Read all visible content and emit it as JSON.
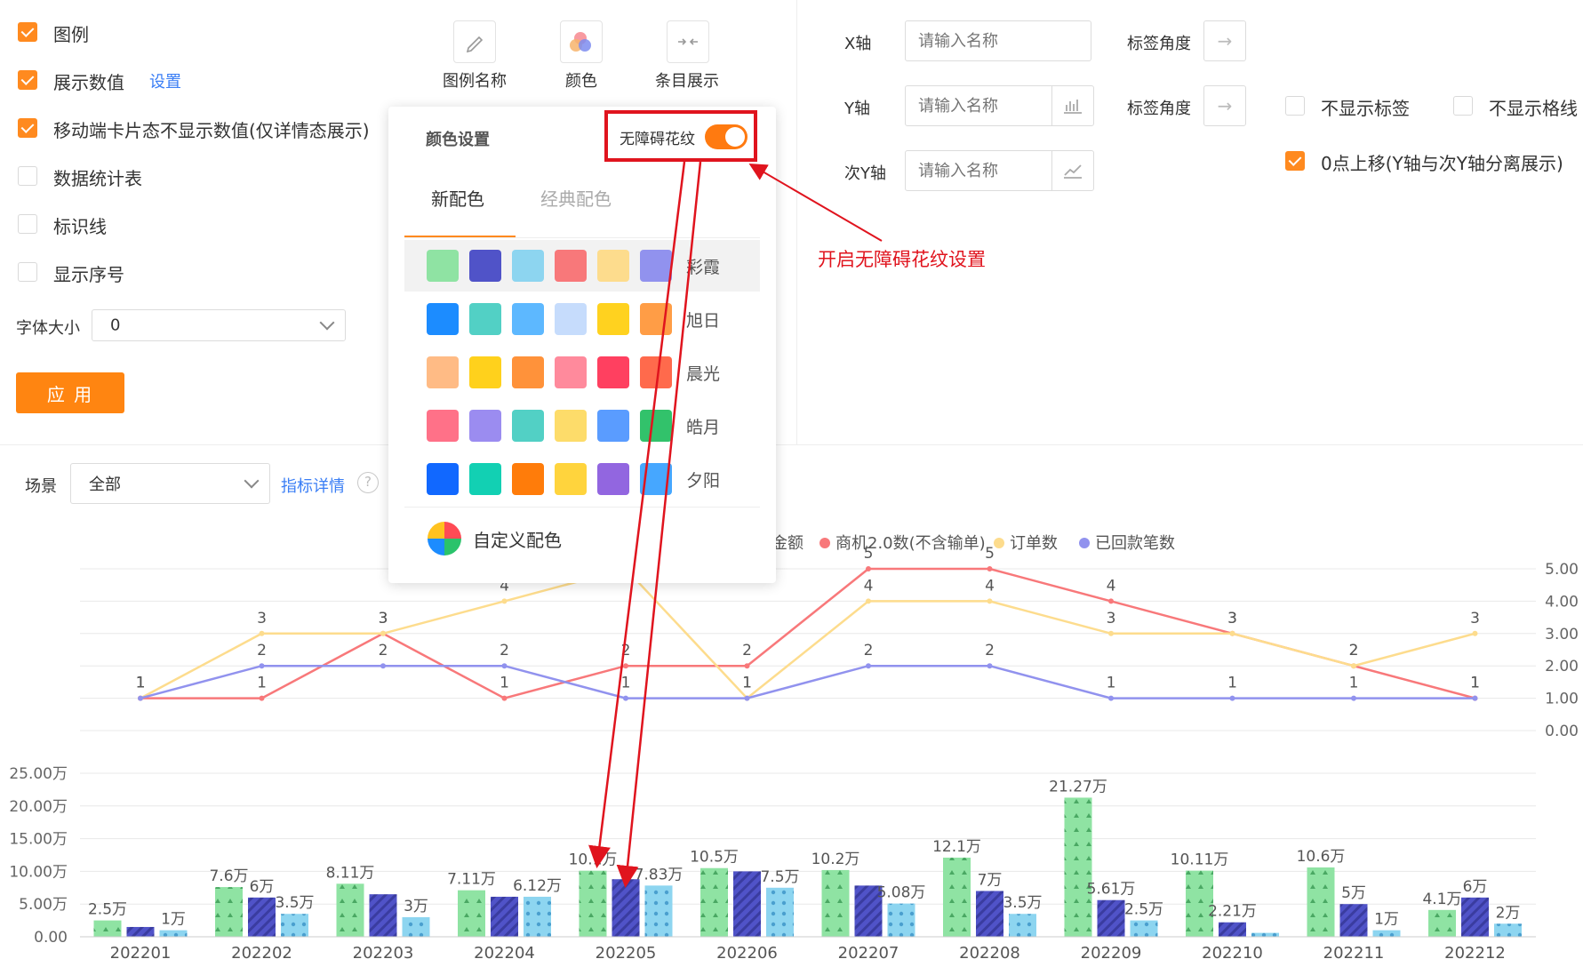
{
  "options": {
    "legend": {
      "label": "图例",
      "checked": true
    },
    "show_values": {
      "label": "展示数值",
      "checked": true,
      "settings_link": "设置"
    },
    "mobile_hide": {
      "label": "移动端卡片态不显示数值(仅详情态展示)",
      "checked": true
    },
    "data_table": {
      "label": "数据统计表",
      "checked": false
    },
    "marker_line": {
      "label": "标识线",
      "checked": false
    },
    "show_index": {
      "label": "显示序号",
      "checked": false
    },
    "font_size_label": "字体大小",
    "font_size_value": "0",
    "apply_label": "应 用"
  },
  "toolbar": {
    "legend_name": "图例名称",
    "color": "颜色",
    "entry_display": "条目展示"
  },
  "axes": {
    "x_label": "X轴",
    "y_label": "Y轴",
    "y2_label": "次Y轴",
    "placeholder": "请输入名称",
    "tick_angle": "标签角度",
    "hide_labels": {
      "label": "不显示标签",
      "checked": false
    },
    "hide_grid": {
      "label": "不显示格线",
      "checked": false
    },
    "zero_shift": {
      "label": "0点上移(Y轴与次Y轴分离展示)",
      "checked": true
    }
  },
  "scene": {
    "label": "场景",
    "value": "全部",
    "detail_link": "指标详情",
    "help": "?"
  },
  "color_popup": {
    "title": "颜色设置",
    "accessibility_label": "无障碍花纹",
    "accessibility_on": true,
    "tabs": [
      "新配色",
      "经典配色"
    ],
    "active_tab": 0,
    "schemes": [
      {
        "name": "彩霞",
        "colors": [
          "#8fe3a3",
          "#5053c8",
          "#8dd5f0",
          "#f8787a",
          "#fddc8d",
          "#9192ee"
        ]
      },
      {
        "name": "旭日",
        "colors": [
          "#1c8cff",
          "#52d0c5",
          "#5db8ff",
          "#c6dcfc",
          "#ffd21f",
          "#ff9d46"
        ]
      },
      {
        "name": "晨光",
        "colors": [
          "#ffbb85",
          "#ffd11c",
          "#ff923a",
          "#ff8a9c",
          "#ff4060",
          "#ff6a4c"
        ]
      },
      {
        "name": "皓月",
        "colors": [
          "#ff7188",
          "#9b8cf0",
          "#52d0c5",
          "#fddc6a",
          "#5a9cff",
          "#32c26b"
        ]
      },
      {
        "name": "夕阳",
        "colors": [
          "#1168ff",
          "#12d0b3",
          "#ff7c0a",
          "#ffd43d",
          "#9266e0",
          "#46a7ff"
        ]
      }
    ],
    "custom_label": "自定义配色"
  },
  "annotation": {
    "text": "开启无障碍花纹设置",
    "color": "#e0141e"
  },
  "chart_data": [
    {
      "type": "line",
      "categories": [
        "202201",
        "202202",
        "202203",
        "202204",
        "202205",
        "202206",
        "202207",
        "202208",
        "202209",
        "202210",
        "202211",
        "202212"
      ],
      "ylim": [
        0,
        5
      ],
      "y_ticks": [
        "0.00",
        "1.00",
        "2.00",
        "3.00",
        "4.00",
        "5.00"
      ],
      "legend_visible": [
        "金额",
        "商机2.0数(不含输单)",
        "订单数",
        "已回款笔数"
      ],
      "series": [
        {
          "name": "商机2.0数(不含输单)",
          "color": "#f8787a",
          "values": [
            1,
            1,
            3,
            1,
            2,
            2,
            5,
            5,
            4,
            3,
            2,
            1
          ]
        },
        {
          "name": "订单数",
          "color": "#fddc8d",
          "values": [
            1,
            3,
            3,
            4,
            5,
            1,
            4,
            4,
            3,
            3,
            2,
            3
          ]
        },
        {
          "name": "已回款笔数",
          "color": "#9192ee",
          "values": [
            1,
            2,
            2,
            2,
            1,
            1,
            2,
            2,
            1,
            1,
            1,
            1
          ]
        }
      ]
    },
    {
      "type": "bar",
      "categories": [
        "202201",
        "202202",
        "202203",
        "202204",
        "202205",
        "202206",
        "202207",
        "202208",
        "202209",
        "202210",
        "202211",
        "202212"
      ],
      "ylim": [
        0,
        25
      ],
      "y_ticks": [
        "0.00",
        "5.00万",
        "10.00万",
        "15.00万",
        "20.00万",
        "25.00万"
      ],
      "series": [
        {
          "color": "#8fe3a3",
          "pattern": "triangles",
          "values": [
            2.5,
            7.6,
            8.11,
            7.11,
            10.1,
            10.5,
            10.2,
            12.1,
            21.27,
            10.11,
            10.6,
            4.1
          ],
          "labels": [
            "2.5万",
            "7.6万",
            "8.11万",
            "7.11万",
            "10.1万",
            "10.5万",
            "10.2万",
            "12.1万",
            "21.27万",
            "10.11万",
            "10.6万",
            "4.1万"
          ]
        },
        {
          "color": "#5053c8",
          "pattern": "stripes",
          "values": [
            1.5,
            6,
            6.5,
            6.12,
            8.8,
            10,
            7.83,
            7,
            5.61,
            2.21,
            5,
            6
          ],
          "labels": [
            "",
            "6万",
            "",
            "",
            "",
            "",
            "",
            "7万",
            "5.61万",
            "2.21万",
            "5万",
            "6万"
          ]
        },
        {
          "color": "#8dd5f0",
          "pattern": "dots",
          "values": [
            1,
            3.5,
            3,
            6.12,
            7.83,
            7.5,
            5.08,
            3.5,
            2.5,
            0.6,
            1,
            2
          ],
          "labels": [
            "1万",
            "3.5万",
            "3万",
            "6.12万",
            "7.83万",
            "7.5万",
            "5.08万",
            "3.5万",
            "2.5万",
            "",
            "1万",
            "2万"
          ]
        }
      ]
    }
  ]
}
